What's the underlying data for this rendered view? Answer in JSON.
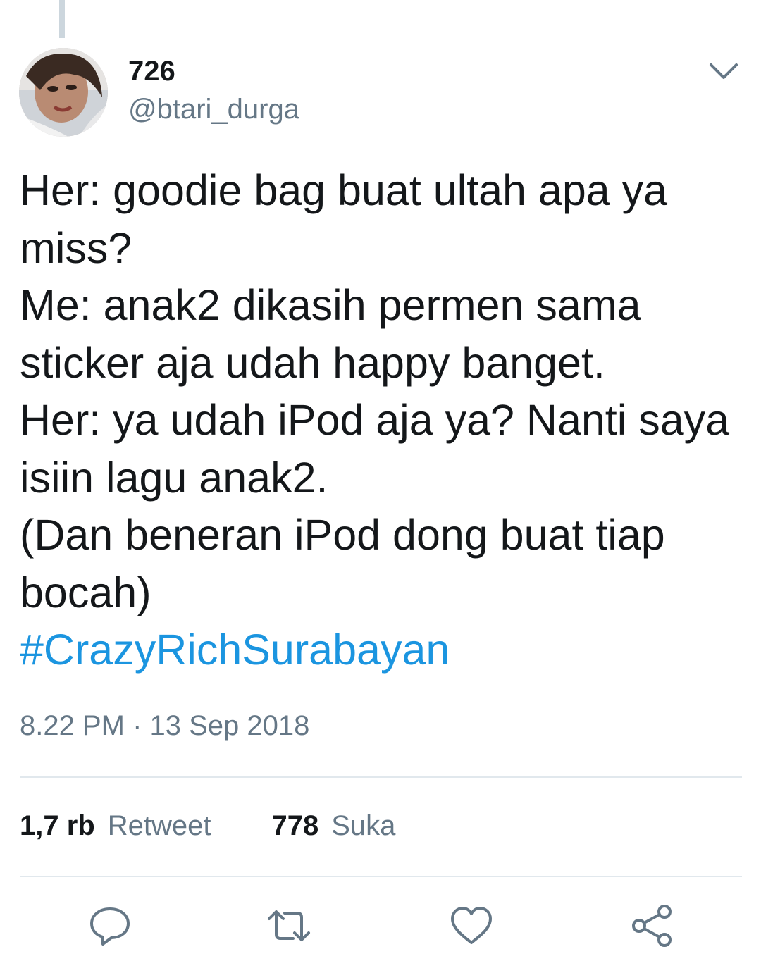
{
  "tweet": {
    "author": {
      "display_name": "726",
      "handle": "@btari_durga"
    },
    "text": "Her: goodie bag buat ultah apa ya\nmiss?\nMe: anak2 dikasih permen sama\nsticker aja udah happy banget.\nHer: ya udah iPod aja ya? Nanti saya\nisiin lagu anak2.\n(Dan beneran iPod dong buat tiap\nbocah)",
    "hashtag": "#CrazyRichSurabayan",
    "timestamp": "8.22 PM · 13 Sep 2018",
    "stats": {
      "retweets_count": "1,7 rb",
      "retweets_label": "Retweet",
      "likes_count": "778",
      "likes_label": "Suka"
    }
  },
  "actions": {
    "reply_icon": "reply-icon",
    "retweet_icon": "retweet-icon",
    "like_icon": "heart-icon",
    "share_icon": "share-icon"
  },
  "colors": {
    "text_primary": "#14171a",
    "text_secondary": "#657786",
    "hashtag": "#1b95e0",
    "divider": "#e1e8ed",
    "icon": "#657786"
  }
}
